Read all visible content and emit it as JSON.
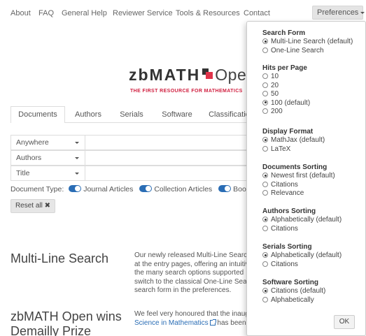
{
  "nav": {
    "links": [
      "About",
      "FAQ",
      "General Help",
      "Reviewer Service",
      "Tools & Resources",
      "Contact"
    ],
    "preferences_label": "Preferences"
  },
  "logo": {
    "bold": "zbMATH",
    "open": "Open",
    "tagline": "THE FIRST RESOURCE FOR MATHEMATICS",
    "colors": {
      "red": "#e0334a",
      "dark": "#333333"
    }
  },
  "tabs": [
    "Documents",
    "Authors",
    "Serials",
    "Software",
    "Classification"
  ],
  "search_rows": [
    {
      "field": "Anywhere",
      "value": ""
    },
    {
      "field": "Authors",
      "value": ""
    },
    {
      "field": "Title",
      "value": ""
    }
  ],
  "doc_types": {
    "label": "Document Type:",
    "items": [
      "Journal Articles",
      "Collection Articles",
      "Books"
    ]
  },
  "reset_label": "Reset all",
  "news": [
    {
      "title_lines": [
        "Multi-Line Search"
      ],
      "text_lines": [
        {
          "text": "Our newly released Multi-Line Search",
          "link": ""
        },
        {
          "text": "at the entry pages, offering an intuitive",
          "link": ""
        },
        {
          "text": "the many search options supported",
          "link": ""
        },
        {
          "text": "switch to the classical One-Line Search",
          "link": ""
        },
        {
          "text": "search form in the preferences.",
          "link": ""
        }
      ]
    },
    {
      "title_lines": [
        "zbMATH Open wins",
        "Demailly Prize"
      ],
      "text_lines": [
        {
          "text": "We feel very honoured that the inaugural",
          "link": ""
        },
        {
          "text": " has been",
          "link": "Science in Mathematics"
        }
      ]
    }
  ],
  "preferences": {
    "sections": [
      {
        "heading": "Search Form",
        "options": [
          "Multi-Line Search (default)",
          "One-Line Search"
        ],
        "selected": 0
      },
      {
        "heading": "Hits per Page",
        "options": [
          "10",
          "20",
          "50",
          "100 (default)",
          "200"
        ],
        "selected": 3
      },
      {
        "heading": "Display Format",
        "options": [
          "MathJax (default)",
          "LaTeX"
        ],
        "selected": 0
      },
      {
        "heading": "Documents Sorting",
        "options": [
          "Newest first (default)",
          "Citations",
          "Relevance"
        ],
        "selected": 0
      },
      {
        "heading": "Authors Sorting",
        "options": [
          "Alphabetically (default)",
          "Citations"
        ],
        "selected": 0
      },
      {
        "heading": "Serials Sorting",
        "options": [
          "Alphabetically (default)",
          "Citations"
        ],
        "selected": 0
      },
      {
        "heading": "Software Sorting",
        "options": [
          "Citations (default)",
          "Alphabetically"
        ],
        "selected": 0
      }
    ],
    "ok_label": "OK"
  },
  "colors": {
    "accent": "#2a6db5",
    "brand_red": "#d02040"
  }
}
